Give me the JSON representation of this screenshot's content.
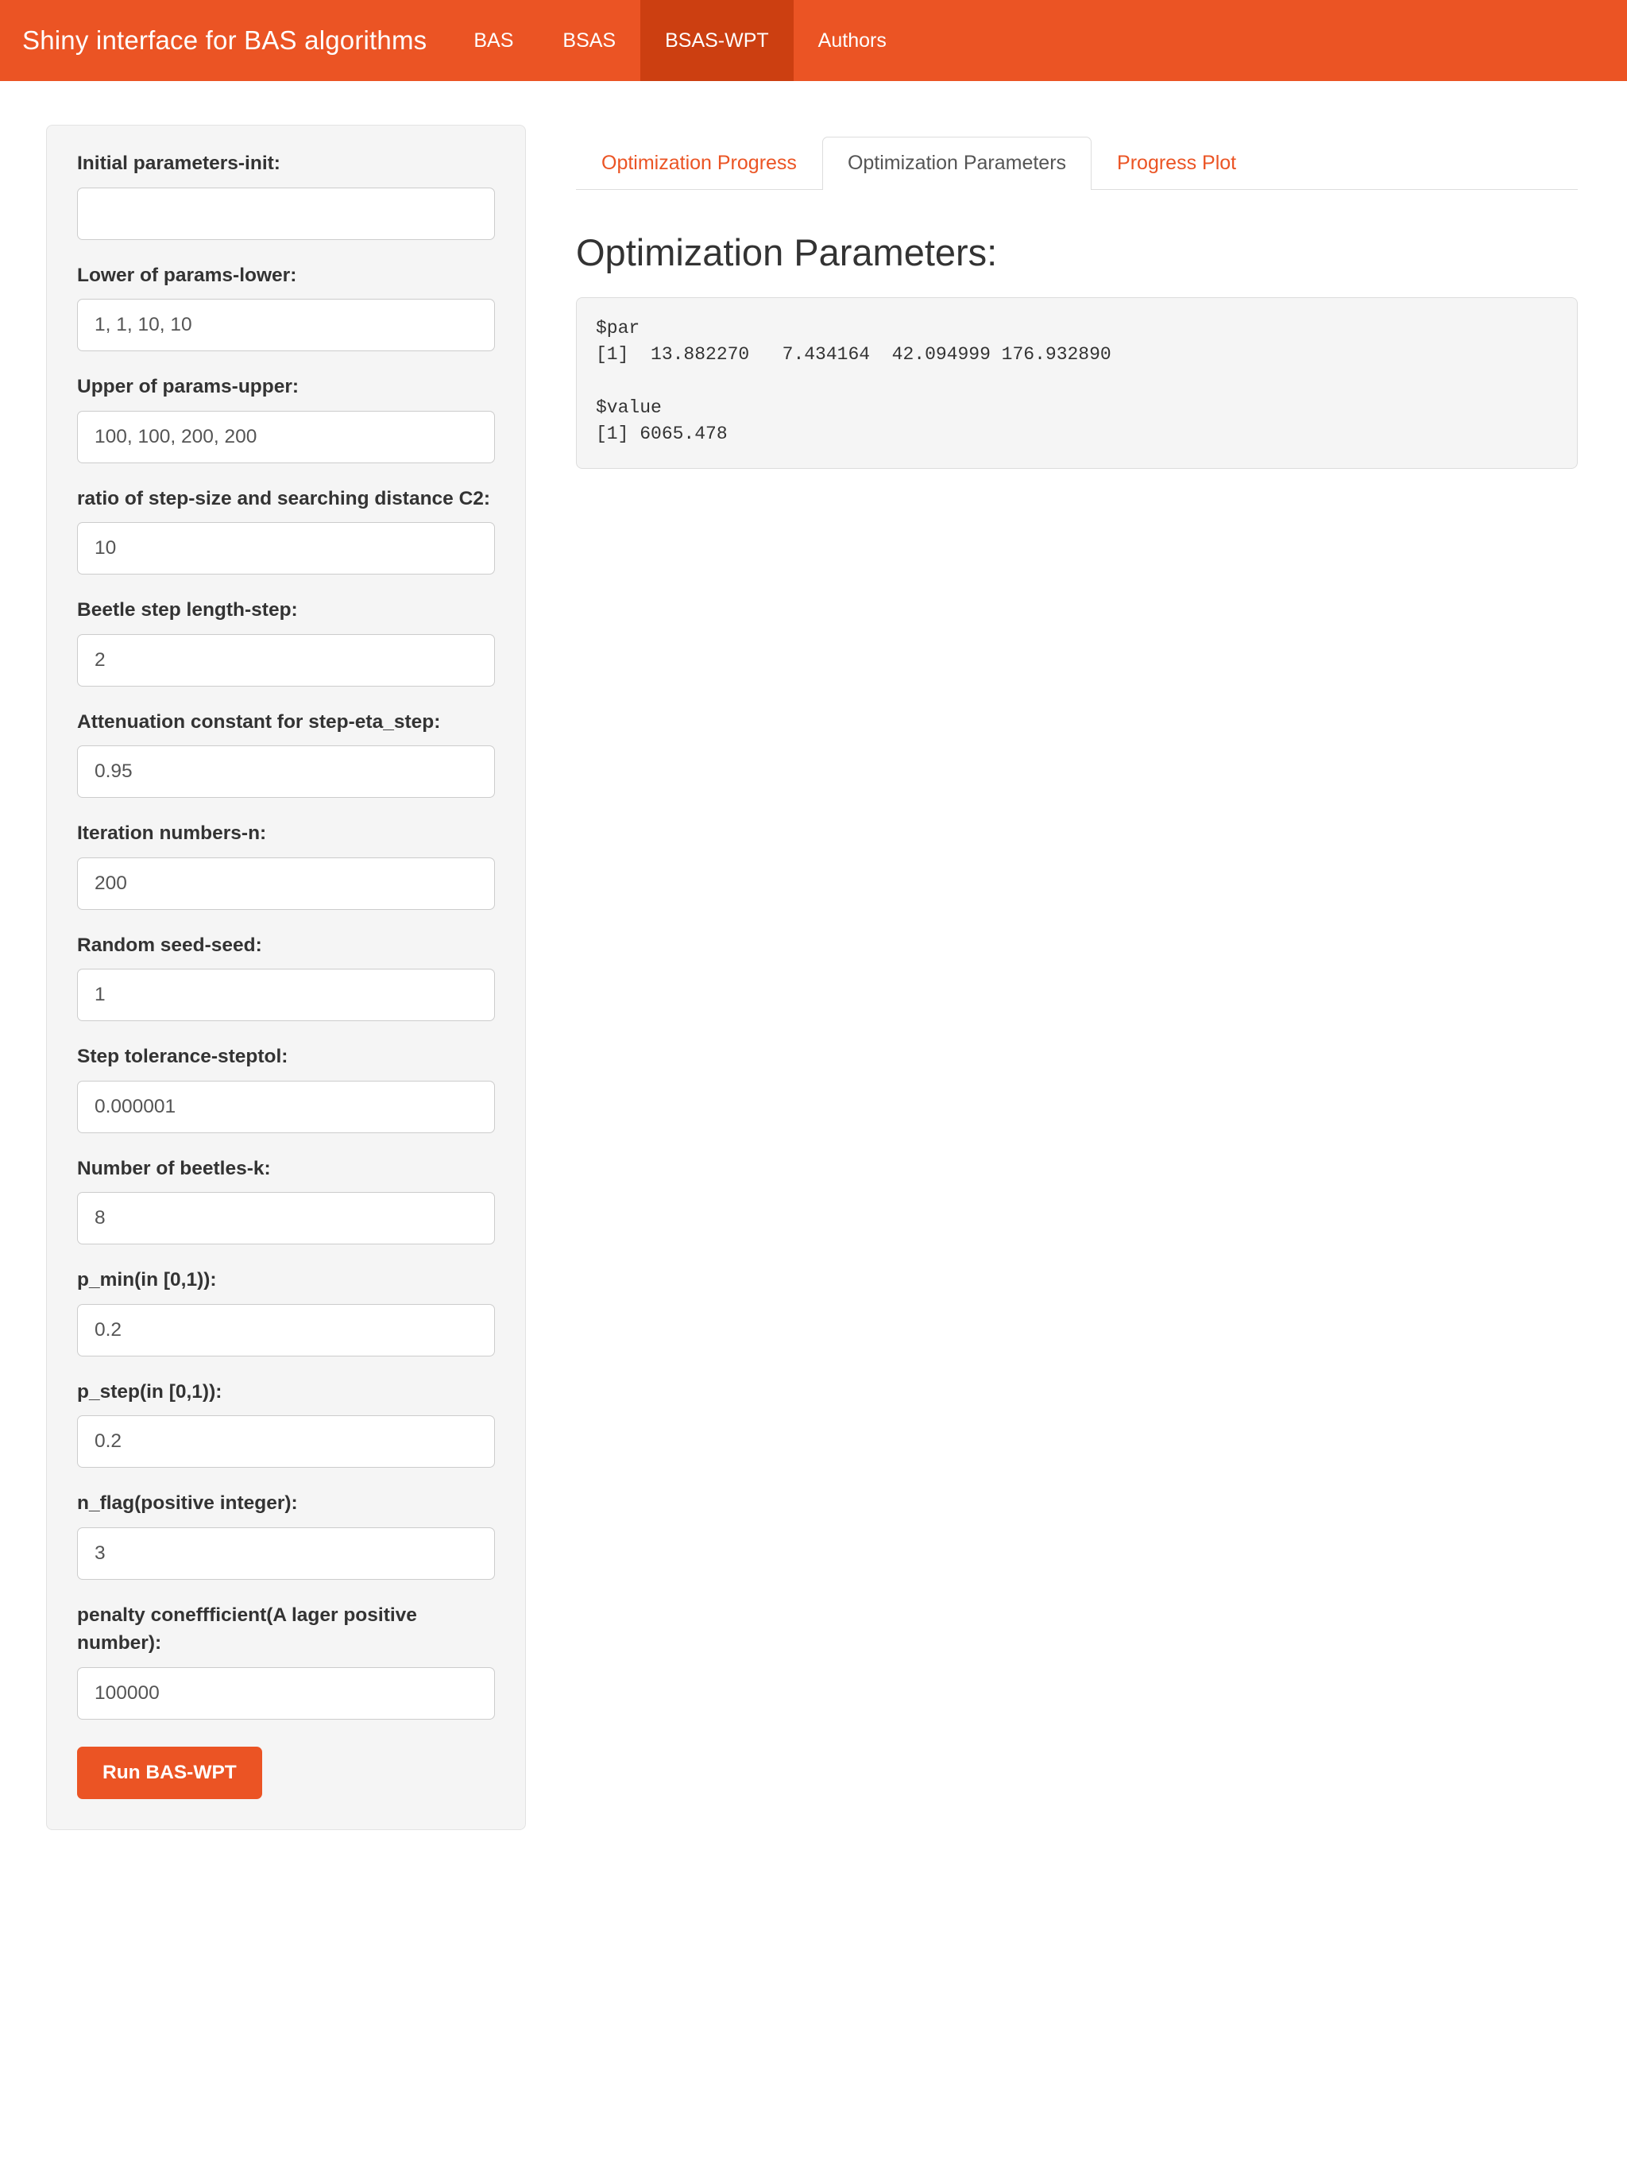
{
  "navbar": {
    "brand": "Shiny interface for BAS algorithms",
    "items": [
      {
        "label": "BAS",
        "active": false
      },
      {
        "label": "BSAS",
        "active": false
      },
      {
        "label": "BSAS-WPT",
        "active": true
      },
      {
        "label": "Authors",
        "active": false
      }
    ],
    "bg_color": "#eb5424",
    "active_bg_color": "#cc3f11"
  },
  "sidebar": {
    "fields": [
      {
        "label": "Initial parameters-init:",
        "value": "",
        "name": "init"
      },
      {
        "label": "Lower of params-lower:",
        "value": "1, 1, 10, 10",
        "name": "lower"
      },
      {
        "label": "Upper of params-upper:",
        "value": "100, 100, 200, 200",
        "name": "upper"
      },
      {
        "label": "ratio of step-size and searching distance C2:",
        "value": "10",
        "name": "c2"
      },
      {
        "label": "Beetle step length-step:",
        "value": "2",
        "name": "step"
      },
      {
        "label": "Attenuation constant for step-eta_step:",
        "value": "0.95",
        "name": "eta-step"
      },
      {
        "label": "Iteration numbers-n:",
        "value": "200",
        "name": "n"
      },
      {
        "label": "Random seed-seed:",
        "value": "1",
        "name": "seed"
      },
      {
        "label": "Step tolerance-steptol:",
        "value": "0.000001",
        "name": "steptol"
      },
      {
        "label": "Number of beetles-k:",
        "value": "8",
        "name": "k"
      },
      {
        "label": "p_min(in [0,1)):",
        "value": "0.2",
        "name": "p-min"
      },
      {
        "label": "p_step(in [0,1)):",
        "value": "0.2",
        "name": "p-step"
      },
      {
        "label": "n_flag(positive integer):",
        "value": "3",
        "name": "n-flag"
      },
      {
        "label": "penalty coneffficient(A lager positive number):",
        "value": "100000",
        "name": "penalty"
      }
    ],
    "run_button": "Run BAS-WPT"
  },
  "main": {
    "tabs": [
      {
        "label": "Optimization Progress",
        "active": false
      },
      {
        "label": "Optimization Parameters",
        "active": true
      },
      {
        "label": "Progress Plot",
        "active": false
      }
    ],
    "panel_title": "Optimization Parameters:",
    "output": "$par\n[1]  13.882270   7.434164  42.094999 176.932890\n\n$value\n[1] 6065.478"
  },
  "theme": {
    "accent": "#eb5424",
    "accent_dark": "#cc3f11",
    "panel_bg": "#f5f5f5",
    "border": "#dddddd",
    "text": "#333333"
  }
}
